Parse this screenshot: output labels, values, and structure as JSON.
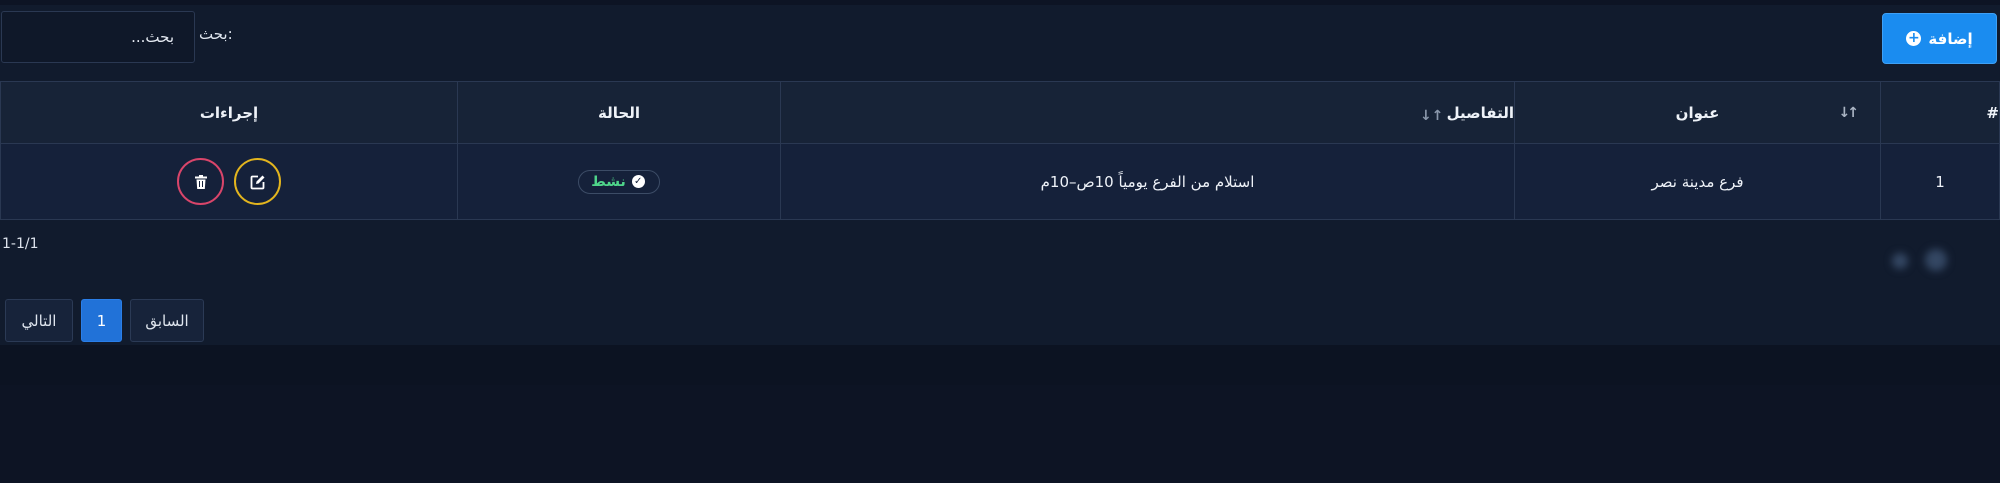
{
  "toolbar": {
    "add_label": "إضافة"
  },
  "search": {
    "label": "بحث:",
    "placeholder": "بحث..."
  },
  "table": {
    "headers": {
      "num": "#",
      "title": "عنوان",
      "details": "التفاصيل",
      "status": "الحالة",
      "actions": "إجراءات"
    },
    "rows": [
      {
        "num": "1",
        "title": "فرع مدينة نصر",
        "details": "استلام من الفرع يومياً 10ص–10م",
        "status": "نشط"
      }
    ]
  },
  "pagination": {
    "range": "1-1/1",
    "prev": "السابق",
    "current": "1",
    "next": "التالي"
  },
  "colors": {
    "accent": "#1a8cf0",
    "active": "#4fd58a",
    "edit": "#e3b51e",
    "delete": "#d9456a"
  },
  "icons": {
    "add": "plus-circle-icon",
    "sort": "sort-icon",
    "status": "check-circle-icon",
    "edit": "edit-icon",
    "delete": "trash-icon"
  }
}
